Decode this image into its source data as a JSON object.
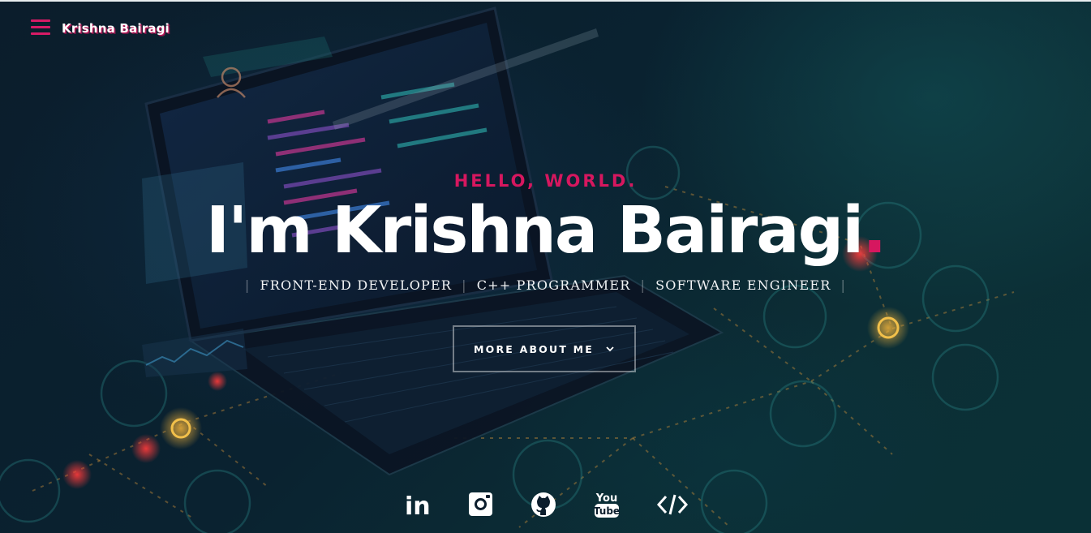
{
  "header": {
    "logo_text": "Krishna Bairagi"
  },
  "intro": {
    "greeting": "HELLO, WORLD.",
    "headline_prefix": "I",
    "headline_rest": "'m Krishna Bairagi",
    "headline_dot": ".",
    "roles": [
      "FRONT-END DEVELOPER",
      "C++ PROGRAMMER",
      "SOFTWARE ENGINEER"
    ],
    "role_separator": "|",
    "more_button_label": "MORE ABOUT ME"
  },
  "social": [
    {
      "name": "linkedin-icon",
      "label": "in"
    },
    {
      "name": "instagram-icon"
    },
    {
      "name": "github-icon"
    },
    {
      "name": "youtube-icon",
      "label_top": "You",
      "label_bottom": "Tube"
    },
    {
      "name": "code-icon",
      "label": "</>"
    }
  ],
  "colors": {
    "accent": "#d6175f",
    "background": "#0b1d2c",
    "text": "#ffffff"
  }
}
